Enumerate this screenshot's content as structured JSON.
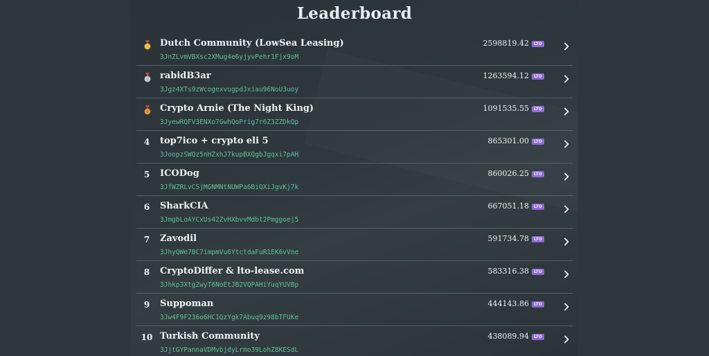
{
  "title": "Leaderboard",
  "token_badge": "LTO",
  "rows": [
    {
      "rank": "1",
      "medal": "gold-medal-icon",
      "name": "Dutch Community (LowSea Leasing)",
      "address": "3JnZLvmVBXsc2XMug4e6yjyvPehr1Fjx9oM",
      "amount": "2598819.42"
    },
    {
      "rank": "2",
      "medal": "silver-medal-icon",
      "name": "rabidB3ar",
      "address": "3Jgz4XTs9zWcogexvugpdJxiau96NoU3uoy",
      "amount": "1263594.12"
    },
    {
      "rank": "3",
      "medal": "bronze-medal-icon",
      "name": "Crypto Arnie (The Night King)",
      "address": "3JyewRQFV3ENXo7GwhQoPrig7r6Z3ZZDkQp",
      "amount": "1091535.55"
    },
    {
      "rank": "4",
      "name": "top7ico + crypto eli 5",
      "address": "3JoopzSWQz5nHZxhJ7kupBXQgbJgqxi7pAH",
      "amount": "865301.00"
    },
    {
      "rank": "5",
      "name": "ICODog",
      "address": "3JfWZRLvCSjMGNMNtNUWPa6BiQXiJgvKj7k",
      "amount": "860026.25"
    },
    {
      "rank": "6",
      "name": "SharkCIA",
      "address": "3JmgbLoAYCxUs42ZvHXbvvMdbt2Pmggoej5",
      "amount": "667051.18"
    },
    {
      "rank": "7",
      "name": "Zavodil",
      "address": "3JhyQWe7BC7impmVu6YtctdaFuR1EK6vVne",
      "amount": "591734.78"
    },
    {
      "rank": "8",
      "name": "CryptoDiffer & lto-lease.com",
      "address": "3Jhkp3Xtg2wyT6NoEtJB2VQPAHiYuqYUVBp",
      "amount": "583316.38"
    },
    {
      "rank": "9",
      "name": "Suppoman",
      "address": "3Jw4F9F236o6HC1QzYgk7Abuq9z98bTFUKe",
      "amount": "444143.86"
    },
    {
      "rank": "10",
      "name": "Turkish Community",
      "address": "3JjtGYPannaVDMvbjdyLrmo39LohZ8KESdL",
      "amount": "438089.94"
    }
  ],
  "colors": {
    "gold": "#e8b23a",
    "silver": "#b9bec4",
    "bronze": "#d9822b",
    "address": "#5fc29a",
    "badge": "#8e6ad1"
  }
}
